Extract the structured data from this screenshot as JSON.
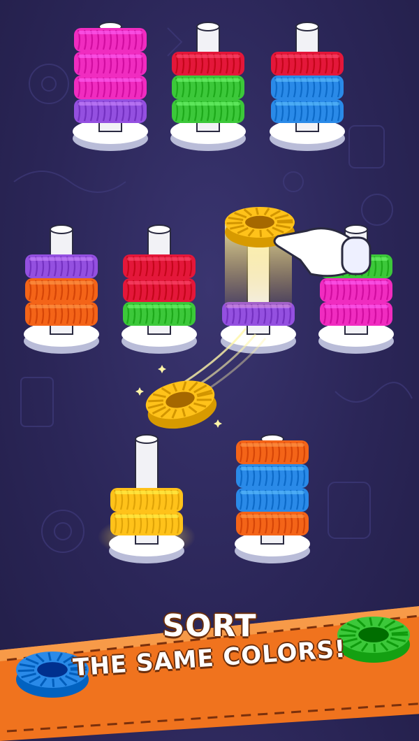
{
  "banner": {
    "line1": "SORT",
    "line2": "THE SAME COLORS!"
  },
  "colors": {
    "pink": "#f02cc0",
    "purple": "#9450e0",
    "red": "#e4173a",
    "green": "#3cc83a",
    "blue": "#2a8ae8",
    "orange": "#f46418",
    "yellow": "#ffc21a",
    "banner": "#f0731e",
    "background": "#2b2658"
  },
  "stacks": [
    {
      "id": "stack-1",
      "rings": [
        "purple",
        "pink",
        "pink",
        "pink"
      ],
      "highlight": false
    },
    {
      "id": "stack-2",
      "rings": [
        "green",
        "green",
        "red"
      ],
      "highlight": false
    },
    {
      "id": "stack-3",
      "rings": [
        "blue",
        "blue",
        "red"
      ],
      "highlight": false
    },
    {
      "id": "stack-4",
      "rings": [
        "orange",
        "orange",
        "purple"
      ],
      "highlight": false
    },
    {
      "id": "stack-5",
      "rings": [
        "green",
        "red",
        "red"
      ],
      "highlight": false
    },
    {
      "id": "stack-6",
      "rings": [
        "purple"
      ],
      "highlight": false
    },
    {
      "id": "stack-7",
      "rings": [
        "pink",
        "pink",
        "green"
      ],
      "highlight": false
    },
    {
      "id": "stack-8",
      "rings": [
        "yellow",
        "yellow"
      ],
      "highlight": true
    },
    {
      "id": "stack-9",
      "rings": [
        "orange",
        "blue",
        "blue",
        "orange"
      ],
      "highlight": false
    }
  ],
  "flying_rings": [
    {
      "id": "lifted-ring",
      "color": "yellow"
    },
    {
      "id": "thrown-ring",
      "color": "yellow"
    }
  ],
  "decor_rings": [
    {
      "id": "banner-ring-left",
      "color": "blue"
    },
    {
      "id": "banner-ring-right",
      "color": "green"
    }
  ]
}
